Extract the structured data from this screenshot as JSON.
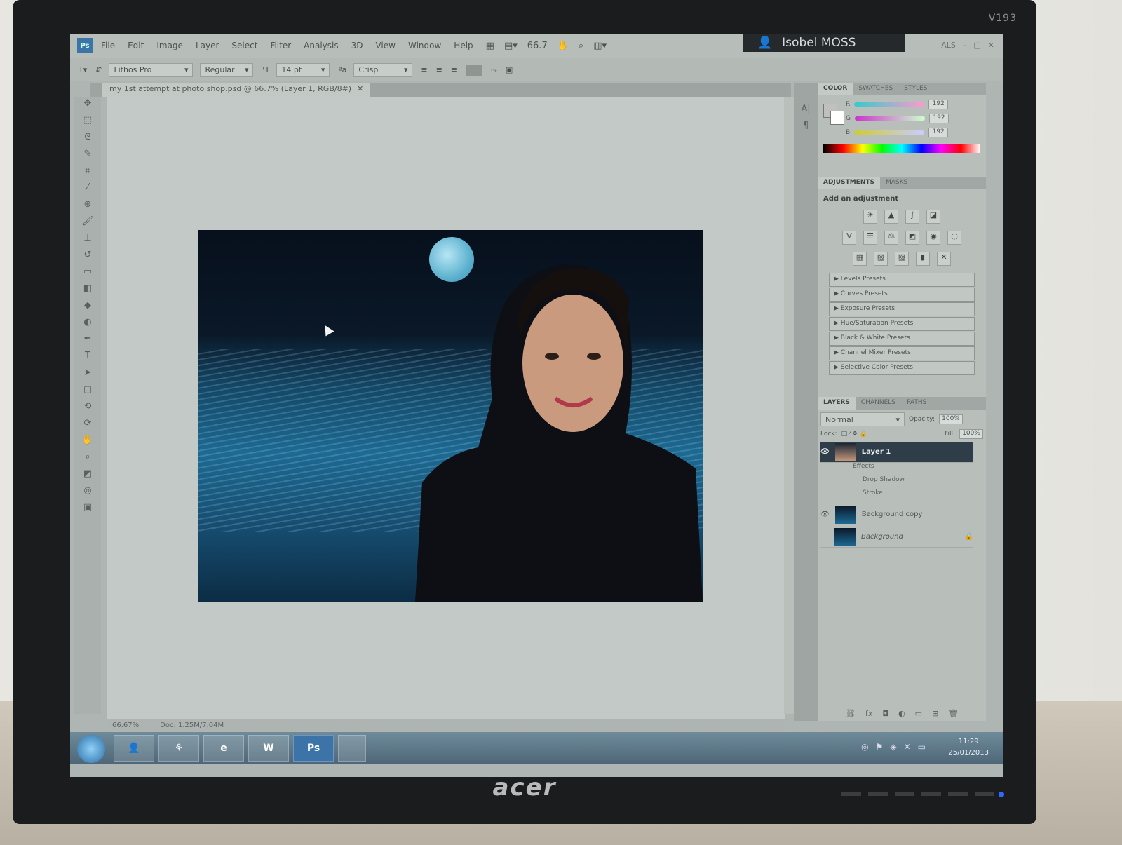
{
  "monitor": {
    "model": "V193",
    "brand": "acer"
  },
  "menu": [
    "File",
    "Edit",
    "Image",
    "Layer",
    "Select",
    "Filter",
    "Analysis",
    "3D",
    "View",
    "Window",
    "Help"
  ],
  "menubar": {
    "zoom": "66.7",
    "user": "Isobel MOSS",
    "essentials": "ALS"
  },
  "options": {
    "font_family": "Lithos Pro",
    "font_style": "Regular",
    "font_size": "14 pt",
    "antialias": "Crisp"
  },
  "document": {
    "tab_title": "my 1st attempt at photo shop.psd @ 66.7% (Layer 1, RGB/8#)",
    "status_zoom": "66.67%",
    "status_doc": "Doc: 1.25M/7.04M"
  },
  "color_panel": {
    "tabs": [
      "COLOR",
      "SWATCHES",
      "STYLES"
    ],
    "r_label": "R",
    "g_label": "G",
    "b_label": "B",
    "r": "192",
    "g": "192",
    "b": "192"
  },
  "adjustments": {
    "tabs": [
      "ADJUSTMENTS",
      "MASKS"
    ],
    "heading": "Add an adjustment",
    "presets": [
      "Levels Presets",
      "Curves Presets",
      "Exposure Presets",
      "Hue/Saturation Presets",
      "Black & White Presets",
      "Channel Mixer Presets",
      "Selective Color Presets"
    ]
  },
  "layers_panel": {
    "tabs": [
      "LAYERS",
      "CHANNELS",
      "PATHS"
    ],
    "blend_mode": "Normal",
    "opacity_label": "Opacity:",
    "opacity": "100%",
    "lock_label": "Lock:",
    "fill_label": "Fill:",
    "fill": "100%",
    "layers": [
      {
        "name": "Layer 1"
      },
      {
        "name": "Background copy"
      },
      {
        "name": "Background"
      }
    ],
    "effects_label": "Effects",
    "effects": [
      "Drop Shadow",
      "Stroke"
    ]
  },
  "taskbar": {
    "time": "11:29",
    "date": "25/01/2013",
    "word_label": "W",
    "ps_label": "Ps"
  },
  "colors": {
    "selected_layer": "#2e3d48",
    "ps_blue": "#3d74a8"
  }
}
